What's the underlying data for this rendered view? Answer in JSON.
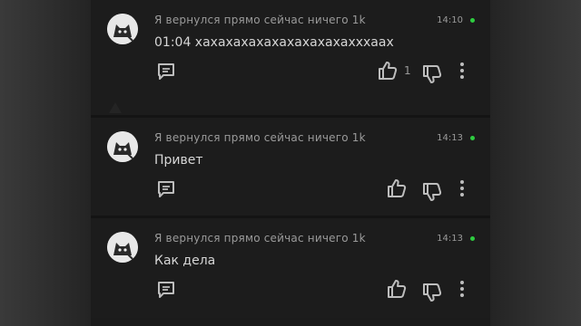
{
  "comments": [
    {
      "author": "Я вернулся прямо сейчас ничего 1k",
      "time": "14:10",
      "text": "01:04 хахахахахахахахахахахххаах",
      "like_count": "1"
    },
    {
      "author": "Я вернулся прямо сейчас ничего 1k",
      "time": "14:13",
      "text": "Привет",
      "like_count": ""
    },
    {
      "author": "Я вернулся прямо сейчас ничего 1k",
      "time": "14:13",
      "text": "Как дела",
      "like_count": ""
    }
  ],
  "icons": {
    "reply": "reply-icon",
    "like": "thumbs-up-icon",
    "dislike": "thumbs-down-icon",
    "more": "more-vertical-icon",
    "online": "online-status-dot"
  },
  "colors": {
    "online": "#2ecc40",
    "text": "#d6d6d6",
    "meta": "#9a9a9a",
    "card": "#1c1c1c"
  }
}
